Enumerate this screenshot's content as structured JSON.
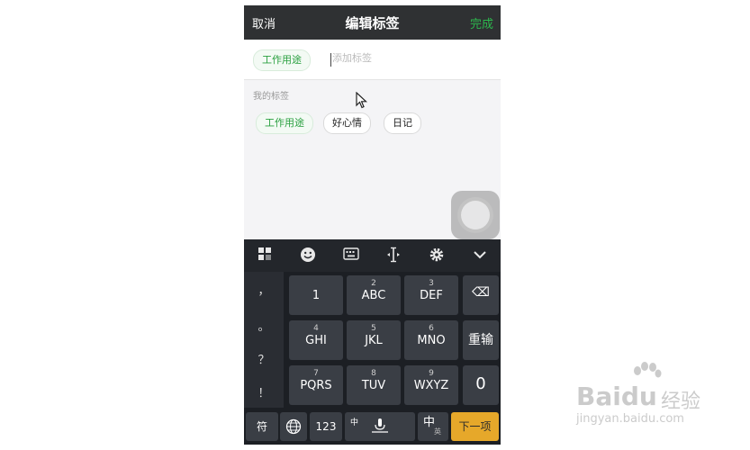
{
  "navbar": {
    "cancel": "取消",
    "title": "编辑标签",
    "done": "完成"
  },
  "input_row": {
    "current_tag": "工作用途",
    "placeholder": "添加标签"
  },
  "my_tags": {
    "label": "我的标签",
    "tags": [
      "工作用途",
      "好心情",
      "日记"
    ]
  },
  "toolbar_icons": [
    "grid-icon",
    "emoji-icon",
    "keyboard-icon",
    "cursor-move-icon",
    "gear-icon",
    "chevron-down-icon"
  ],
  "keyboard": {
    "punctuation": [
      "，",
      "。",
      "？",
      "！"
    ],
    "keys": [
      {
        "num": "",
        "main": "1"
      },
      {
        "num": "2",
        "main": "ABC"
      },
      {
        "num": "3",
        "main": "DEF"
      },
      {
        "num": "4",
        "main": "GHI"
      },
      {
        "num": "5",
        "main": "JKL"
      },
      {
        "num": "6",
        "main": "MNO"
      },
      {
        "num": "7",
        "main": "PQRS"
      },
      {
        "num": "8",
        "main": "TUV"
      },
      {
        "num": "9",
        "main": "WXYZ"
      }
    ],
    "backspace": "⌫",
    "reenter": "重输",
    "zero": "0",
    "symbol": "符",
    "num_switch": "123",
    "space_label": "中",
    "lang_switch": "中",
    "lang_sub": "英",
    "next": "下一项"
  },
  "colors": {
    "accent": "#2db84d",
    "next_key": "#e6a82a",
    "navbar": "#2f3133"
  },
  "watermark": {
    "brand": "Baidu",
    "cn": "经验",
    "url": "jingyan.baidu.com"
  }
}
